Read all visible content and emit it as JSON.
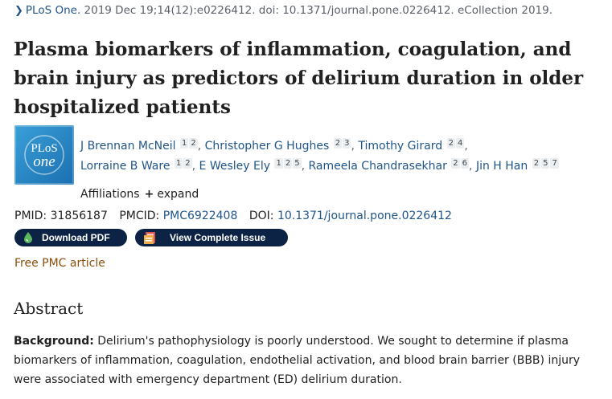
{
  "citation": {
    "journal": "PLoS One.",
    "details": "2019 Dec 19;14(12):e0226412. doi: 10.1371/journal.pone.0226412. eCollection 2019."
  },
  "article": {
    "title": "Plasma biomarkers of inflammation, coagulation, and brain injury as predictors of delirium duration in older hospitalized patients"
  },
  "logo": {
    "line1": "PLoS",
    "line2": "one",
    "color": "#2a88c8"
  },
  "authors": [
    {
      "name": "J Brennan McNeil",
      "affils": [
        "1",
        "2"
      ]
    },
    {
      "name": "Christopher G Hughes",
      "affils": [
        "2",
        "3"
      ]
    },
    {
      "name": "Timothy Girard",
      "affils": [
        "2",
        "4"
      ]
    },
    {
      "name": "Lorraine B Ware",
      "affils": [
        "1",
        "2"
      ]
    },
    {
      "name": "E Wesley Ely",
      "affils": [
        "1",
        "2",
        "5"
      ]
    },
    {
      "name": "Rameela Chandrasekhar",
      "affils": [
        "2",
        "6"
      ]
    },
    {
      "name": "Jin H Han",
      "affils": [
        "2",
        "5",
        "7"
      ]
    }
  ],
  "affiliations": {
    "label": "Affiliations",
    "expand_icon": "+",
    "expand_label": "expand"
  },
  "ids": {
    "pmid_label": "PMID:",
    "pmid": "31856187",
    "pmcid_label": "PMCID:",
    "pmcid": "PMC6922408",
    "doi_label": "DOI:",
    "doi": "10.1371/journal.pone.0226412"
  },
  "buttons": {
    "download_pdf": "Download PDF",
    "view_issue": "View Complete Issue"
  },
  "free_pmc": "Free PMC article",
  "abstract": {
    "heading": "Abstract",
    "background_label": "Background:",
    "background_text": "Delirium's pathophysiology is poorly understood. We sought to determine if plasma biomarkers of inflammation, coagulation, endothelial activation, and blood brain barrier (BBB) injury were associated with emergency department (ED) delirium duration."
  },
  "colors": {
    "link": "#20558a",
    "button_bg": "#0d2345",
    "free_article": "#8a4f0d",
    "pdf_icon": "#5cb85c"
  }
}
